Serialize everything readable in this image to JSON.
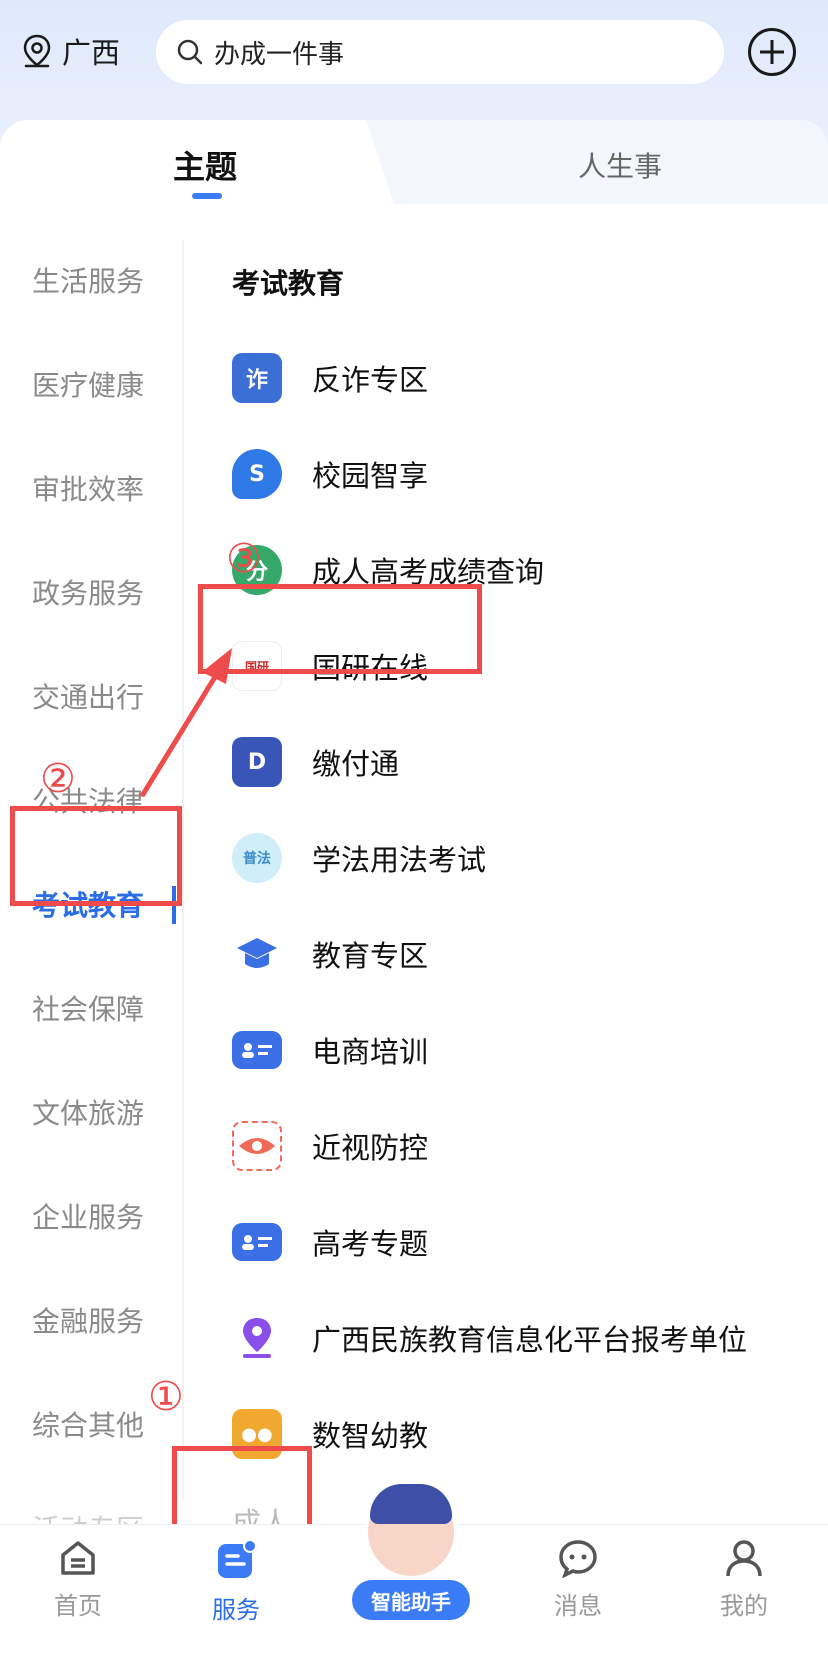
{
  "header": {
    "location": "广西",
    "search_text": "办成一件事"
  },
  "tabs": [
    {
      "label": "主题",
      "active": true
    },
    {
      "label": "人生事",
      "active": false
    }
  ],
  "sidebar": {
    "items": [
      {
        "label": "生活服务"
      },
      {
        "label": "医疗健康"
      },
      {
        "label": "审批效率"
      },
      {
        "label": "政务服务"
      },
      {
        "label": "交通出行"
      },
      {
        "label": "公共法律"
      },
      {
        "label": "考试教育",
        "active": true
      },
      {
        "label": "社会保障"
      },
      {
        "label": "文体旅游"
      },
      {
        "label": "企业服务"
      },
      {
        "label": "金融服务"
      },
      {
        "label": "综合其他"
      },
      {
        "label": "活动专区"
      }
    ]
  },
  "content": {
    "title": "考试教育",
    "items": [
      {
        "label": "反诈专区",
        "icon": "shield-icon",
        "color": "#3b6fd6"
      },
      {
        "label": "校园智享",
        "icon": "campus-icon",
        "color": "#2f79e6"
      },
      {
        "label": "成人高考成绩查询",
        "icon": "exam-icon",
        "color": "#35a86a"
      },
      {
        "label": "国研在线",
        "icon": "guoyan-logo",
        "color": "#c4302b"
      },
      {
        "label": "缴付通",
        "icon": "pay-icon",
        "color": "#3a55b8"
      },
      {
        "label": "学法用法考试",
        "icon": "law-icon",
        "color": "#8fd4f0"
      },
      {
        "label": "教育专区",
        "icon": "graduation-cap-icon",
        "color": "#3b6fe6"
      },
      {
        "label": "电商培训",
        "icon": "id-card-icon",
        "color": "#3b6fe6"
      },
      {
        "label": "近视防控",
        "icon": "eye-icon",
        "color": "#f06a5a"
      },
      {
        "label": "高考专题",
        "icon": "id-card-icon",
        "color": "#3b6fe6"
      },
      {
        "label": "广西民族教育信息化平台报考单位",
        "icon": "location-pin-icon",
        "color": "#8a4fe8"
      },
      {
        "label": "数智幼教",
        "icon": "robot-icon",
        "color": "#f0a830"
      }
    ],
    "partial_item": "成人..."
  },
  "annotations": {
    "num1": "①",
    "num2": "②",
    "num3": "③",
    "box_color": "#ef4b4b"
  },
  "bottom_nav": {
    "items": [
      {
        "label": "首页",
        "icon": "home-icon"
      },
      {
        "label": "服务",
        "icon": "service-icon",
        "active": true
      },
      {
        "label": "消息",
        "icon": "message-icon"
      },
      {
        "label": "我的",
        "icon": "user-icon"
      }
    ],
    "assistant_label": "智能助手"
  }
}
